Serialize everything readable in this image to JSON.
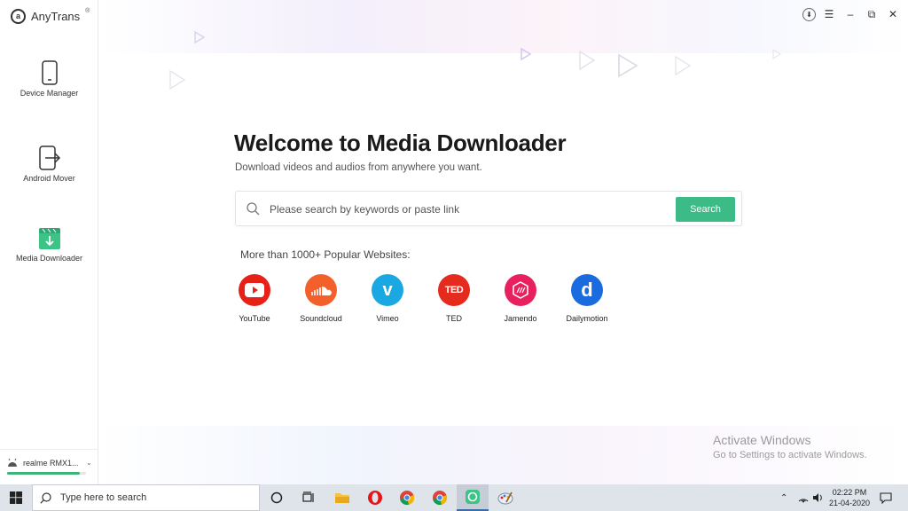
{
  "app": {
    "name": "AnyTrans",
    "registered_mark": "®"
  },
  "sidebar": {
    "items": [
      {
        "label": "Device Manager",
        "icon": "phone-icon"
      },
      {
        "label": "Android Mover",
        "icon": "transfer-icon"
      },
      {
        "label": "Media Downloader",
        "icon": "media-download-icon"
      }
    ]
  },
  "device": {
    "name": "realme RMX1...",
    "icon": "android-icon",
    "storage_used_fraction": 0.92
  },
  "main": {
    "title": "Welcome to Media Downloader",
    "subtitle": "Download videos and audios from anywhere you want.",
    "search_placeholder": "Please search by keywords or paste link",
    "search_button": "Search",
    "popular_label": "More than 1000+ Popular Websites:",
    "sites": [
      {
        "label": "YouTube",
        "color": "#e62117"
      },
      {
        "label": "Soundcloud",
        "color": "#f3602b"
      },
      {
        "label": "Vimeo",
        "color": "#19a8e2"
      },
      {
        "label": "TED",
        "color": "#e52a1e"
      },
      {
        "label": "Jamendo",
        "color": "#e8205f"
      },
      {
        "label": "Dailymotion",
        "color": "#1b6be0"
      }
    ]
  },
  "watermark": {
    "title": "Activate Windows",
    "subtitle": "Go to Settings to activate Windows."
  },
  "taskbar": {
    "search_placeholder": "Type here to search",
    "time": "02:22 PM",
    "date": "21-04-2020"
  },
  "colors": {
    "accent": "#3dbb87",
    "taskbar": "#dfe4ea"
  }
}
